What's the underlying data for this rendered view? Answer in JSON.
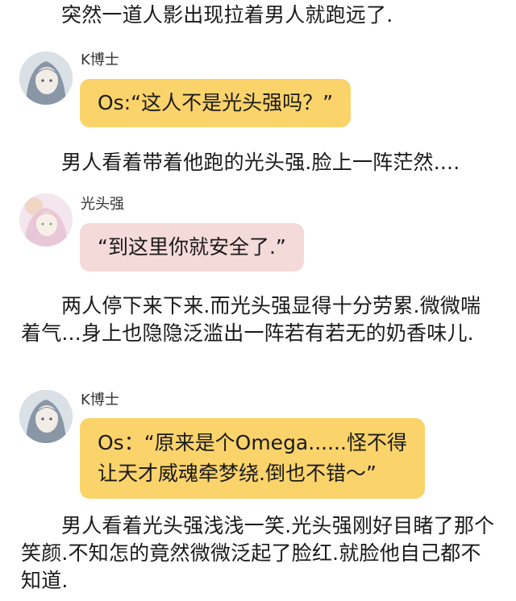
{
  "narration": [
    "突然一道人影出现拉着男人就跑远了.",
    "男人看着带着他跑的光头强.脸上一阵茫然....",
    "两人停下来下来.而光头强显得十分劳累.微微喘着气...身上也隐隐泛滥出一阵若有若无的奶香味儿.",
    "男人看着光头强浅浅一笑.光头强刚好目睹了那个笑颜.不知怎的竟然微微泛起了脸红.就脸他自己都不知道."
  ],
  "messages": [
    {
      "speaker": "K博士",
      "text": "Os:“这人不是光头强吗？”",
      "color": "#fbd36b"
    },
    {
      "speaker": "光头强",
      "text": "“到这里你就安全了.”",
      "color": "#f5dada"
    },
    {
      "speaker": "K博士",
      "text_lines": [
        "Os：“原来是个Omega......怪不得",
        "让天才威魂牵梦绕.倒也不错～”"
      ],
      "color": "#fbd36b"
    }
  ]
}
